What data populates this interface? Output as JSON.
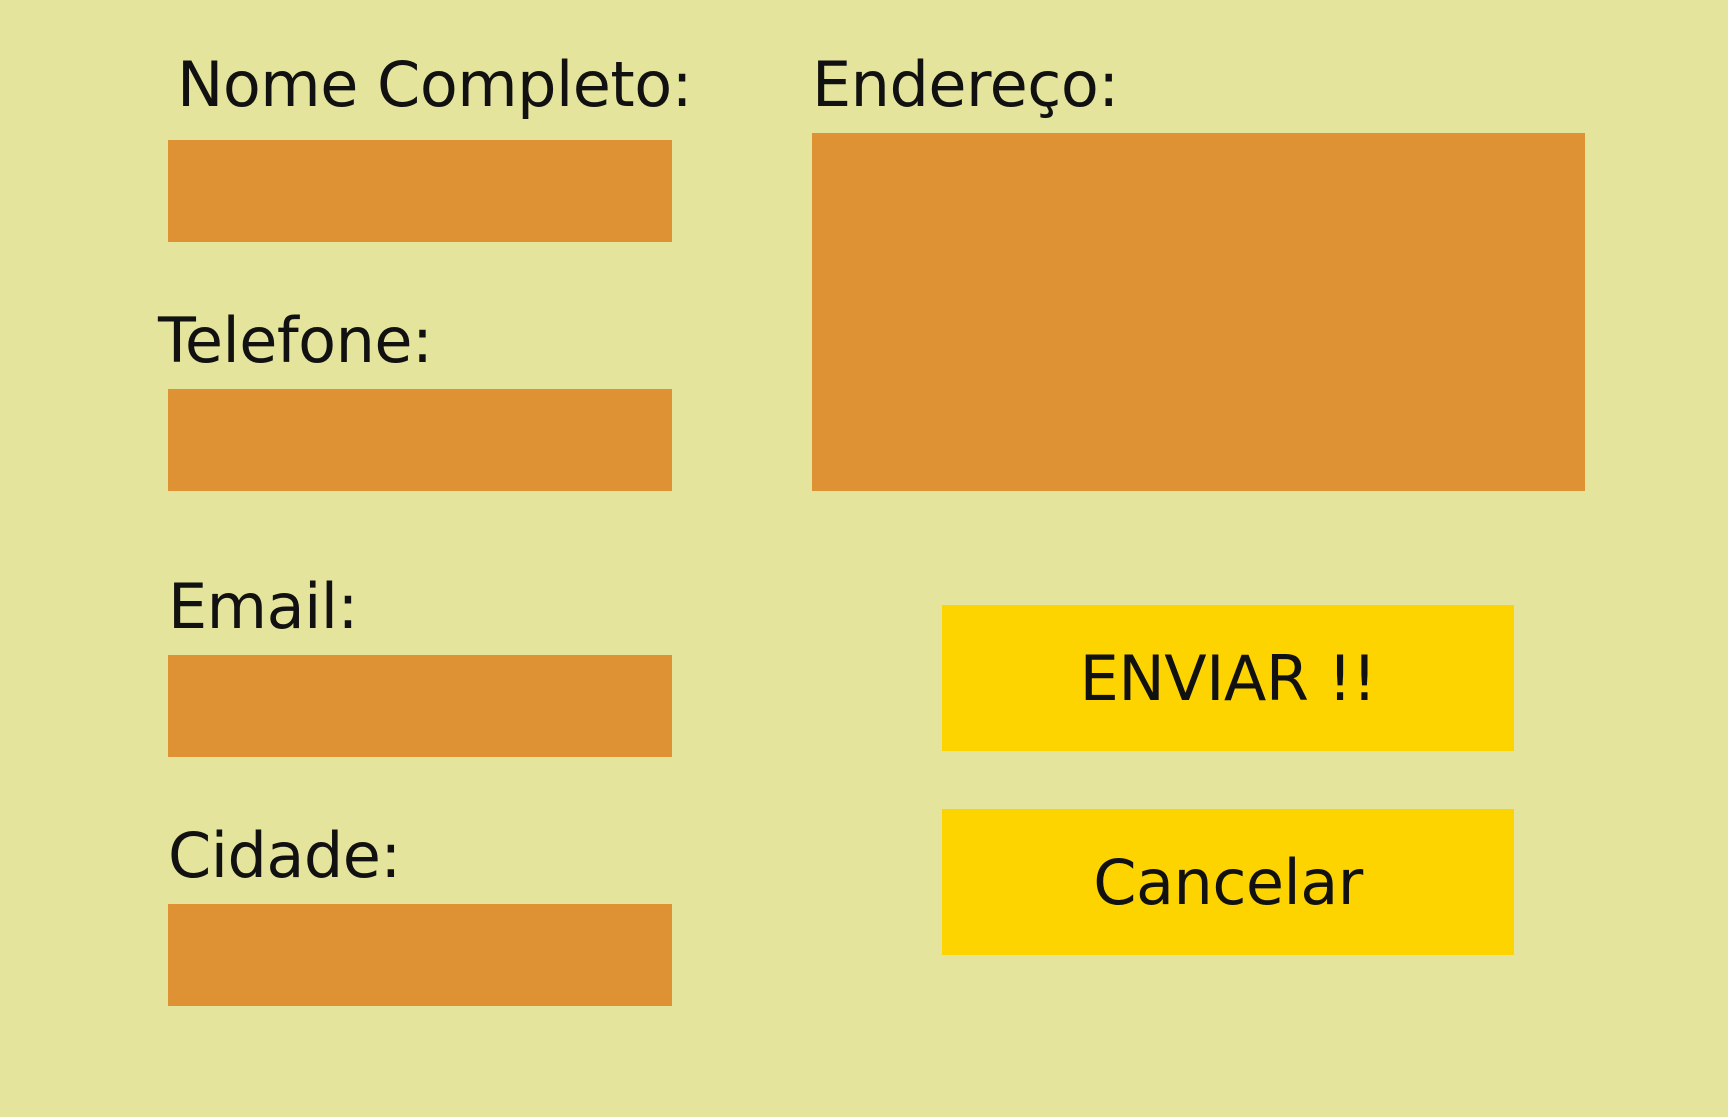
{
  "form": {
    "fields": {
      "nome_completo": {
        "label": "Nome Completo:",
        "value": ""
      },
      "telefone": {
        "label": "Telefone:",
        "value": ""
      },
      "email": {
        "label": "Email:",
        "value": ""
      },
      "cidade": {
        "label": "Cidade:",
        "value": ""
      },
      "endereco": {
        "label": "Endereço:",
        "value": ""
      }
    },
    "buttons": {
      "submit_label": "ENVIAR !!",
      "cancel_label": "Cancelar"
    }
  },
  "colors": {
    "background": "#e4e49c",
    "field": "#de9234",
    "button": "#fdd300",
    "text": "#111111"
  }
}
